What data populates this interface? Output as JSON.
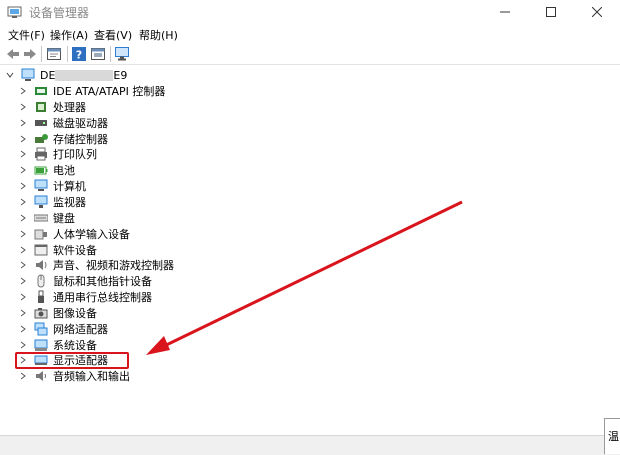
{
  "window": {
    "title": "设备管理器",
    "minimize": "—",
    "maximize": "☐",
    "close": "✕"
  },
  "menu": [
    "文件(F)",
    "操作(A)",
    "查看(V)",
    "帮助(H)"
  ],
  "tree": {
    "root": {
      "prefix": "DE",
      "suffix": "E9"
    },
    "items": [
      {
        "label": "IDE ATA/ATAPI 控制器",
        "icon": "ide-controller-icon",
        "color": "#2a8a3a"
      },
      {
        "label": "处理器",
        "icon": "processor-icon",
        "color": "#3c7f32"
      },
      {
        "label": "磁盘驱动器",
        "icon": "disk-drive-icon",
        "color": "#555555"
      },
      {
        "label": "存储控制器",
        "icon": "storage-controller-icon",
        "color": "#4a7a3a"
      },
      {
        "label": "打印队列",
        "icon": "printer-icon",
        "color": "#666666"
      },
      {
        "label": "电池",
        "icon": "battery-icon",
        "color": "#3aa03a"
      },
      {
        "label": "计算机",
        "icon": "computer-icon",
        "color": "#2a7fd4"
      },
      {
        "label": "监视器",
        "icon": "monitor-icon",
        "color": "#2a7fd4"
      },
      {
        "label": "键盘",
        "icon": "keyboard-icon",
        "color": "#777777"
      },
      {
        "label": "人体学输入设备",
        "icon": "hid-icon",
        "color": "#777777"
      },
      {
        "label": "软件设备",
        "icon": "software-device-icon",
        "color": "#666666"
      },
      {
        "label": "声音、视频和游戏控制器",
        "icon": "speaker-icon",
        "color": "#777777"
      },
      {
        "label": "鼠标和其他指针设备",
        "icon": "mouse-icon",
        "color": "#777777"
      },
      {
        "label": "通用串行总线控制器",
        "icon": "usb-icon",
        "color": "#555555"
      },
      {
        "label": "图像设备",
        "icon": "camera-icon",
        "color": "#555555"
      },
      {
        "label": "网络适配器",
        "icon": "network-adapter-icon",
        "color": "#2a7fd4"
      },
      {
        "label": "系统设备",
        "icon": "system-device-icon",
        "color": "#2a7fd4"
      },
      {
        "label": "显示适配器",
        "icon": "display-adapter-icon",
        "color": "#2a7fd4"
      },
      {
        "label": "音频输入和输出",
        "icon": "audio-io-icon",
        "color": "#777777"
      }
    ]
  },
  "corner_text": "温",
  "annotation": {
    "color": "#d9141c"
  }
}
